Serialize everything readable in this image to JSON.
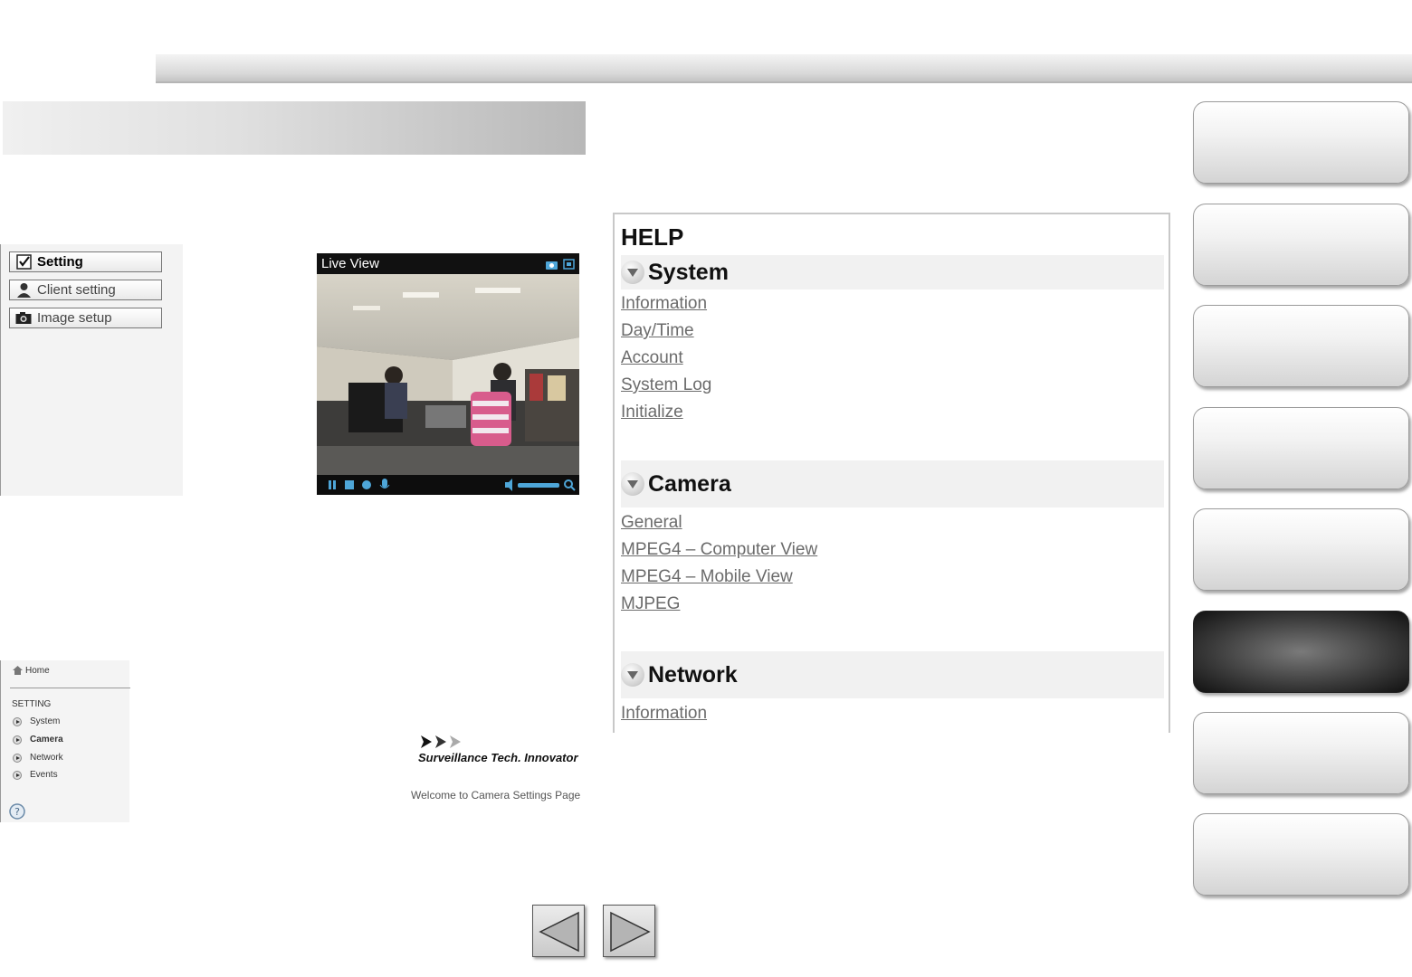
{
  "settings_menu": {
    "items": [
      {
        "label": "Setting",
        "icon": "checkbox-icon",
        "active": true
      },
      {
        "label": "Client setting",
        "icon": "user-icon",
        "active": false
      },
      {
        "label": "Image setup",
        "icon": "camera-icon",
        "active": false
      }
    ]
  },
  "live_view": {
    "title": "Live View"
  },
  "settings_nav": {
    "home_label": "Home",
    "section_label": "SETTING",
    "items": [
      "System",
      "Camera",
      "Network",
      "Events"
    ]
  },
  "brand": {
    "tagline": "Surveillance Tech. Innovator",
    "welcome": "Welcome to Camera Settings Page"
  },
  "help": {
    "title": "HELP",
    "sections": [
      {
        "label": "System",
        "links": [
          "Information",
          "Day/Time",
          "Account",
          "System Log",
          "Initialize"
        ]
      },
      {
        "label": "Camera",
        "links": [
          "General",
          "MPEG4 – Computer View",
          "MPEG4 – Mobile View",
          "MJPEG"
        ]
      },
      {
        "label": "Network",
        "links": [
          "Information"
        ]
      }
    ]
  },
  "side_nav": {
    "active_index": 5,
    "count": 8
  },
  "colors": {
    "active_side_button": "#3a3a3a",
    "link": "#6b6b6b"
  }
}
